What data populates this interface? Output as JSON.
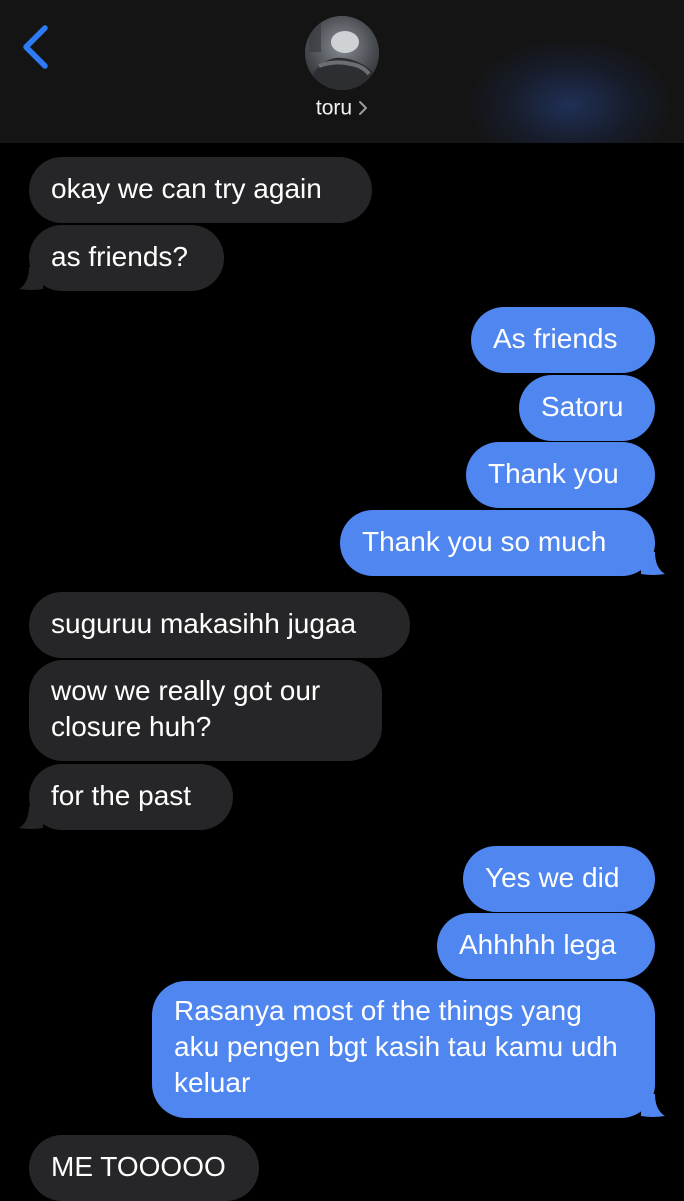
{
  "header": {
    "contact_name": "toru",
    "back_icon": "chevron-left-icon",
    "chevron_icon": "chevron-right-icon",
    "avatar_icon": "contact-avatar"
  },
  "colors": {
    "sent": "#4f86ef",
    "received": "#262628",
    "accent": "#2f7bf6",
    "background": "#000000"
  },
  "messages": [
    {
      "from": "received",
      "text": "okay we can try again"
    },
    {
      "from": "received",
      "text": "as friends?"
    },
    {
      "from": "sent",
      "text": "As friends"
    },
    {
      "from": "sent",
      "text": "Satoru"
    },
    {
      "from": "sent",
      "text": "Thank you"
    },
    {
      "from": "sent",
      "text": "Thank you so much"
    },
    {
      "from": "received",
      "text": "suguruu makasihh jugaa"
    },
    {
      "from": "received",
      "text": "wow we really got our closure huh?"
    },
    {
      "from": "received",
      "text": "for the past"
    },
    {
      "from": "sent",
      "text": "Yes we did"
    },
    {
      "from": "sent",
      "text": "Ahhhhh lega"
    },
    {
      "from": "sent",
      "text": "Rasanya most of the things yang aku pengen bgt kasih tau kamu udh keluar"
    },
    {
      "from": "received",
      "text": "ME TOOOOO"
    }
  ]
}
